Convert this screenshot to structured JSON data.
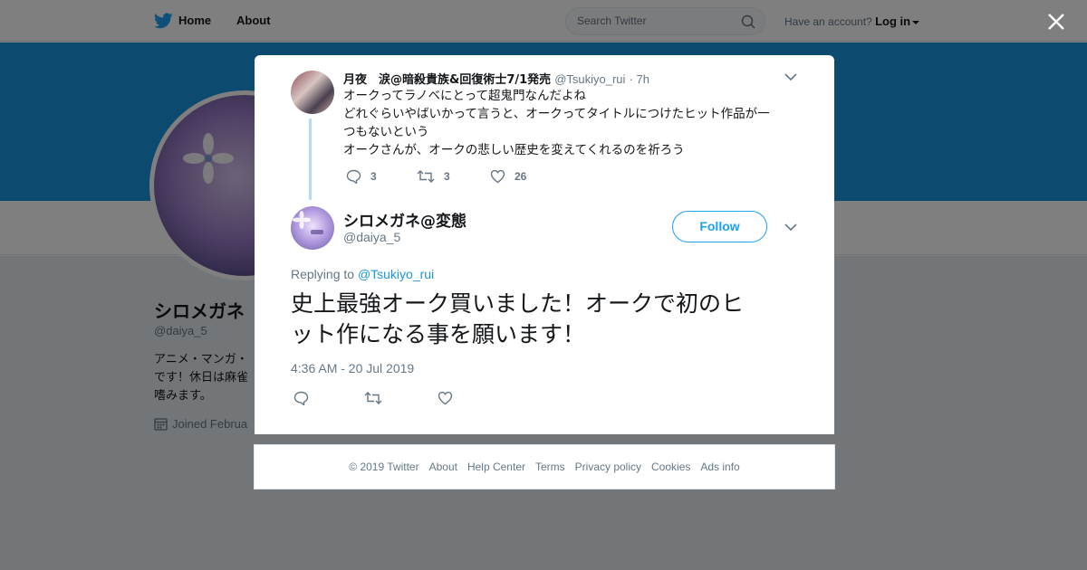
{
  "nav": {
    "home_label": "Home",
    "about_label": "About",
    "search_placeholder": "Search Twitter",
    "account_prompt": "Have an account?",
    "login_label": "Log in"
  },
  "profile": {
    "name": "シロメガネ",
    "handle": "@daiya_5",
    "bio_lines": [
      "アニメ・マンガ・",
      "です！休日は麻雀",
      "嗜みます。"
    ],
    "joined": "Joined Februa"
  },
  "parent_tweet": {
    "author_name": "月夜　涙@暗殺貴族&回復術士7/1発売",
    "author_handle": "@Tsukiyo_rui",
    "time": "· 7h",
    "lines": [
      "オークってラノベにとって超鬼門なんだよね",
      "どれぐらいやばいかって言うと、オークってタイトルにつけたヒット作品が一",
      "つもないという",
      "オークさんが、オークの悲しい歴史を変えてくれるのを祈ろう"
    ],
    "reply_count": "3",
    "retweet_count": "3",
    "like_count": "26"
  },
  "main_tweet": {
    "author_name": "シロメガネ@変態",
    "author_handle": "@daiya_5",
    "follow_label": "Follow",
    "replying_prefix": "Replying to",
    "replying_to": "@Tsukiyo_rui",
    "text_line1": "史上最強オーク買いました！オークで初のヒ",
    "text_line2": "ット作になる事を願います！",
    "timestamp": "4:36 AM - 20 Jul 2019"
  },
  "footer": {
    "links": [
      "© 2019 Twitter",
      "About",
      "Help Center",
      "Terms",
      "Privacy policy",
      "Cookies",
      "Ads info"
    ]
  },
  "colors": {
    "brand_blue": "#1da1f2",
    "banner_blue": "#1b95e0",
    "muted_text": "#657786",
    "overlay": "rgba(0,0,0,0.5)"
  }
}
